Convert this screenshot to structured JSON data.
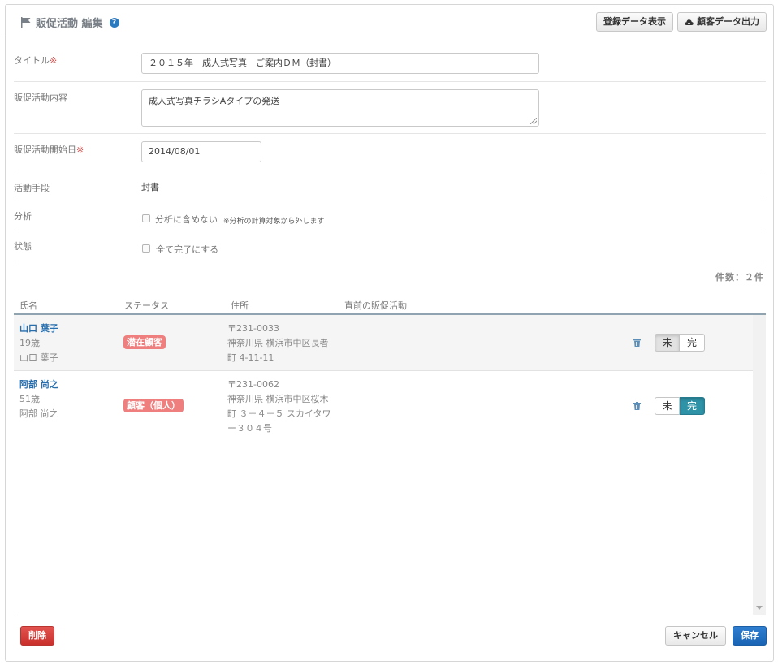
{
  "header": {
    "title": "販促活動 編集",
    "help_glyph": "?",
    "btn_registered": "登録データ表示",
    "btn_export": "顧客データ出力"
  },
  "form": {
    "title_label": "タイトル",
    "title_value": "２０１５年　成人式写真　ご案内ＤＭ（封書）",
    "content_label": "販促活動内容",
    "content_value": "成人式写真チラシAタイプの発送",
    "start_label": "販促活動開始日",
    "start_value": "2014/08/01",
    "method_label": "活動手段",
    "method_value": "封書",
    "analysis_label": "分析",
    "analysis_check": "分析に含めない",
    "analysis_note": "※分析の計算対象から外します",
    "status_label": "状態",
    "status_check": "全て完了にする",
    "required_mark": "※"
  },
  "list": {
    "count_text": "件数：２件",
    "columns": [
      "氏名",
      "ステータス",
      "住所",
      "直前の販促活動"
    ],
    "rows": [
      {
        "name": "山口 葉子",
        "age": "19歳",
        "kana": "山口 葉子",
        "status": "潜在顧客",
        "postal": "〒231-0033",
        "addr1": "神奈川県 横浜市中区長者",
        "addr2": "町 4-11-11",
        "addr3": "",
        "btn_not_done": "未",
        "btn_done": "完",
        "state": "未"
      },
      {
        "name": "阿部 尚之",
        "age": "51歳",
        "kana": "阿部 尚之",
        "status": "顧客（個人）",
        "postal": "〒231-0062",
        "addr1": "神奈川県 横浜市中区桜木",
        "addr2": "町 ３－４－５ スカイタワ",
        "addr3": "ー３０４号",
        "btn_not_done": "未",
        "btn_done": "完",
        "state": "完"
      }
    ]
  },
  "footer": {
    "delete_label": "削除",
    "cancel_label": "キャンセル",
    "save_label": "保存"
  },
  "colors": {
    "accent": "#1a64b4",
    "danger": "#c9302c",
    "done_active": "#2f93a8",
    "badge": "#ef7e7e",
    "link": "#2a6fad"
  },
  "icons": {
    "title": "flag-icon",
    "help": "help-icon",
    "export": "cloud-download-icon",
    "row_action": "trash-icon"
  }
}
